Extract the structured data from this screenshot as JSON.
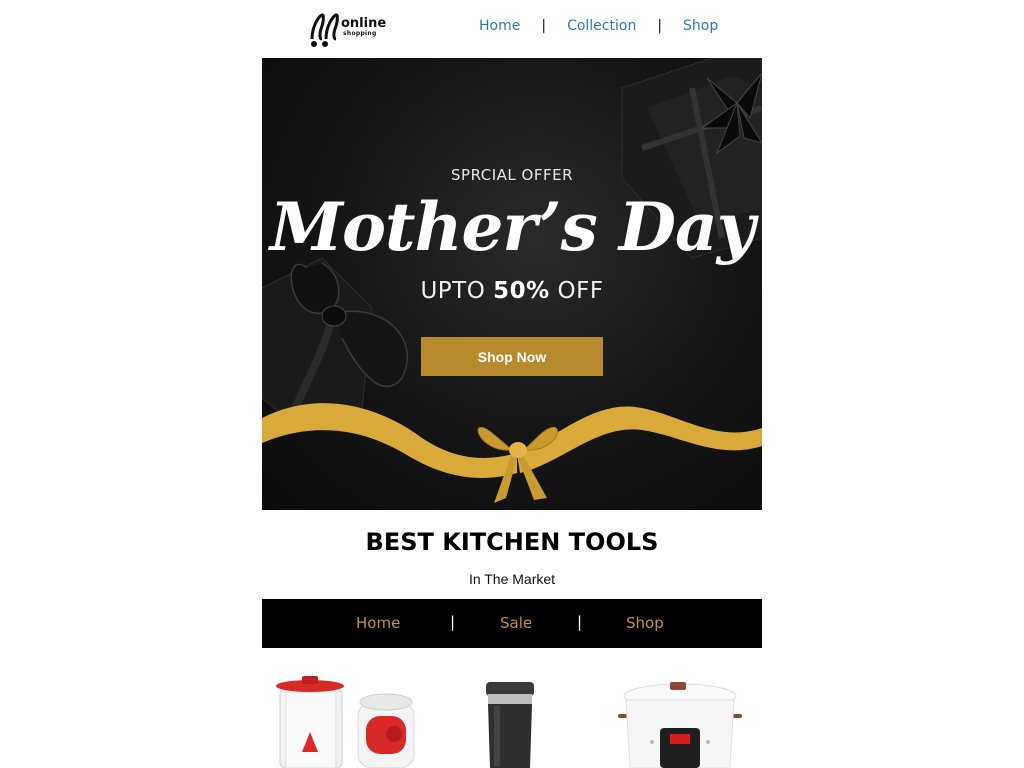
{
  "header": {
    "logo_text": "online",
    "logo_sub": "shopping",
    "nav": [
      {
        "label": "Home"
      },
      {
        "label": "Collection"
      },
      {
        "label": "Shop"
      }
    ],
    "separator": "|"
  },
  "hero": {
    "subtitle": "SPRCIAL OFFER",
    "title": "Mother’s Day",
    "discount_prefix": "UPTO ",
    "discount_value": "50%",
    "discount_suffix": " OFF",
    "cta_label": "Shop Now",
    "colors": {
      "cta": "#b88a2e",
      "ribbon": "#d9a93a",
      "background": "#141414"
    }
  },
  "section": {
    "title": "BEST KITCHEN TOOLS",
    "subtitle": "In The Market"
  },
  "category_nav": {
    "items": [
      {
        "label": "Home"
      },
      {
        "label": "Sale"
      },
      {
        "label": "Shop"
      }
    ],
    "separator": "|",
    "colors": {
      "background": "#000000",
      "text": "#c8923a"
    }
  },
  "products": [
    {
      "icon": "blender-image"
    },
    {
      "icon": "travel-mug-image"
    },
    {
      "icon": "pressure-cooker-image"
    }
  ]
}
